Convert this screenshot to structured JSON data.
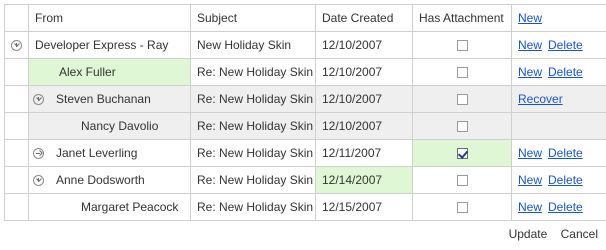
{
  "columns": {
    "from": "From",
    "subject": "Subject",
    "date": "Date Created",
    "attachment": "Has Attachment",
    "new_link": "New"
  },
  "links": {
    "new": "New",
    "delete": "Delete",
    "recover": "Recover"
  },
  "rows": [
    {
      "from": "Developer Express - Ray",
      "subject": "New Holiday Skin",
      "date": "12/10/2007",
      "has_attachment": false
    },
    {
      "from": "Alex Fuller",
      "subject": "Re: New Holiday Skin",
      "date": "12/10/2007",
      "has_attachment": false
    },
    {
      "from": "Steven Buchanan",
      "subject": "Re: New Holiday Skin",
      "date": "12/10/2007",
      "has_attachment": false
    },
    {
      "from": "Nancy Davolio",
      "subject": "Re: New Holiday Skin",
      "date": "12/10/2007",
      "has_attachment": false
    },
    {
      "from": "Janet Leverling",
      "subject": "Re: New Holiday Skin",
      "date": "12/11/2007",
      "has_attachment": true
    },
    {
      "from": "Anne Dodsworth",
      "subject": "Re: New Holiday Skin",
      "date": "12/14/2007",
      "has_attachment": false
    },
    {
      "from": "Margaret Peacock",
      "subject": "Re: New Holiday Skin",
      "date": "12/15/2007",
      "has_attachment": false
    }
  ],
  "footer": {
    "update": "Update",
    "cancel": "Cancel"
  },
  "colors": {
    "link": "#1a55c2",
    "edited_cell": "#dff7d4",
    "deleted_row": "#efefef",
    "border": "#cfcfcf"
  }
}
